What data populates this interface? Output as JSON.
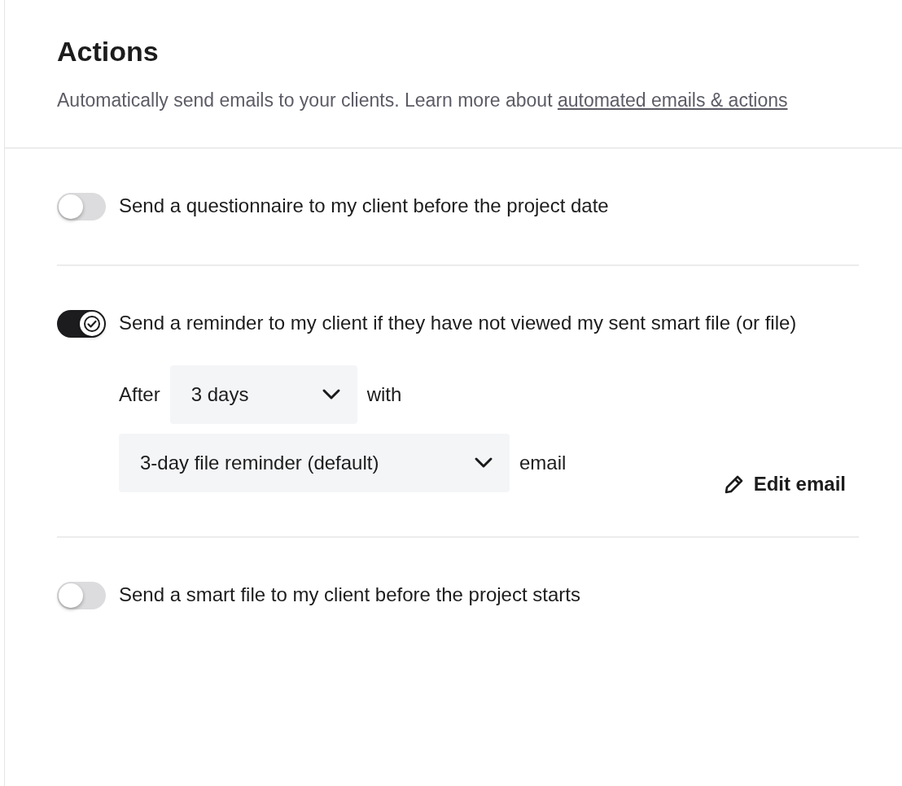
{
  "title": "Actions",
  "description": "Automatically send emails to your clients. Learn more about ",
  "link": "automated emails & actions",
  "actions": [
    {
      "label": "Send a questionnaire to my client before the project date",
      "on": false
    },
    {
      "label": "Send a reminder to my client if they have not viewed my sent smart file (or file)",
      "on": true,
      "settings": {
        "after_label": "After",
        "delay": "3 days",
        "with_label": "with",
        "template": "3-day file reminder (default)",
        "email_label": "email",
        "edit": "Edit email"
      }
    },
    {
      "label": "Send a smart file to my client before the project starts",
      "on": false
    }
  ]
}
